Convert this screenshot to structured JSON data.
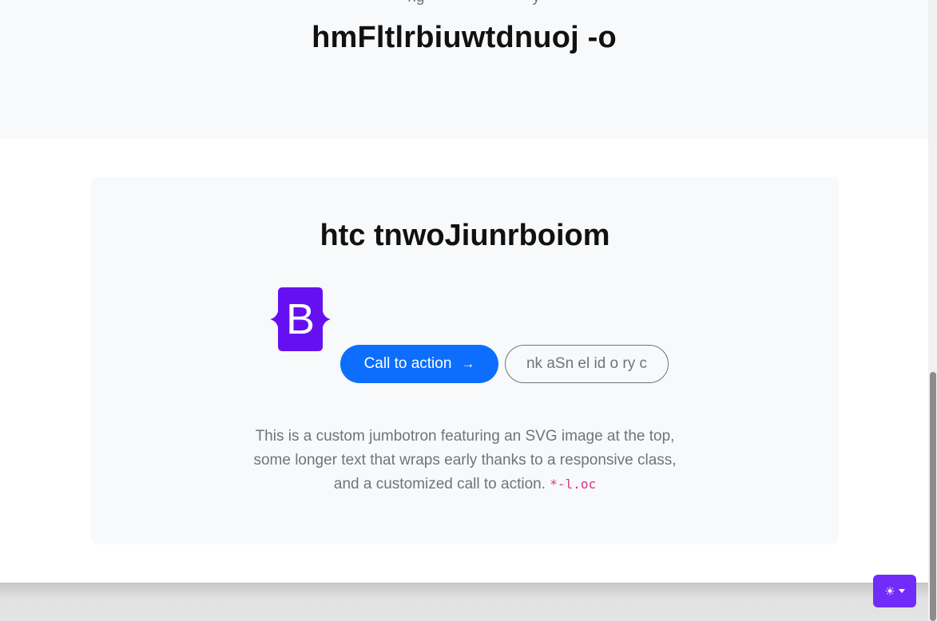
{
  "header": {
    "cut_text": "— — —ng—— — — — —y— —",
    "title": "hmFltlrbiuwtdnuoj -o"
  },
  "jumbotron": {
    "title": "htc tnwoJiunrboiom",
    "logo_letter": "B",
    "primary_button": "Call to action",
    "primary_arrow": "→",
    "secondary_button": "nk aSn el id o ry c",
    "lead_line1": "This is a custom jumbotron featuring an SVG image at the top,",
    "lead_line2": "some longer text that wraps early thanks to a responsive class,",
    "lead_line3": "and a customized call to action.",
    "lead_code": "*-l.oc"
  },
  "theme_toggle": {
    "icon": "sun-icon",
    "glyph": "☀"
  },
  "colors": {
    "primary": "#0d6efd",
    "bootstrap_purple": "#712cf9",
    "logo_purple": "#6610f2",
    "code_pink": "#d63384"
  }
}
